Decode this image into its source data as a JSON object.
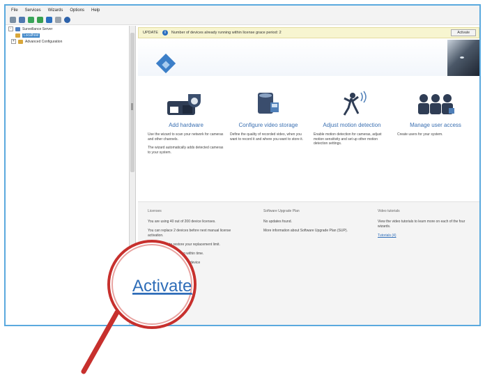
{
  "menu": [
    "File",
    "Services",
    "Wizards",
    "Options",
    "Help"
  ],
  "tree": {
    "server": "Surveillance Server",
    "child": "Localhost",
    "advanced": "Advanced Configuration"
  },
  "update_bar": {
    "tag": "UPDATE",
    "message": "Number of devices already running within license grace period: 2",
    "button": "Activate"
  },
  "tasks": [
    {
      "title": "Add hardware",
      "desc": "Use the wizard to scan your network for cameras and other channels.",
      "desc2": "The wizard automatically adds detected cameras to your system."
    },
    {
      "title": "Configure video storage",
      "desc": "Define the quality of recorded video, when you want to record it and where you want to store it."
    },
    {
      "title": "Adjust motion detection",
      "desc": "Enable motion detection for cameras, adjust motion sensitivity and set up other motion detection settings."
    },
    {
      "title": "Manage user access",
      "desc": "Create users for your system."
    }
  ],
  "license": {
    "heading": "Licenses",
    "line1": "You are using 40 out of 200 device licenses.",
    "line2": "You can replace 2 devices before next manual license activation.",
    "line3": "Click Activate to restore your replacement limit.",
    "line4": "...rporating within time.",
    "line5": "...ire one device"
  },
  "software": {
    "heading": "Software Upgrade Plan",
    "line1": "No updates found.",
    "line2": "More information about Software Upgrade Plan (SUP)."
  },
  "video": {
    "heading": "Video tutorials",
    "line1": "View the video tutorials to learn more on each of the four wizards.",
    "link": "Tutorials (4)"
  },
  "magnifier": {
    "label": "Activate"
  },
  "colors": {
    "accent": "#3c7fc8",
    "lens_ring": "#c7302d",
    "link": "#2e6db8"
  }
}
